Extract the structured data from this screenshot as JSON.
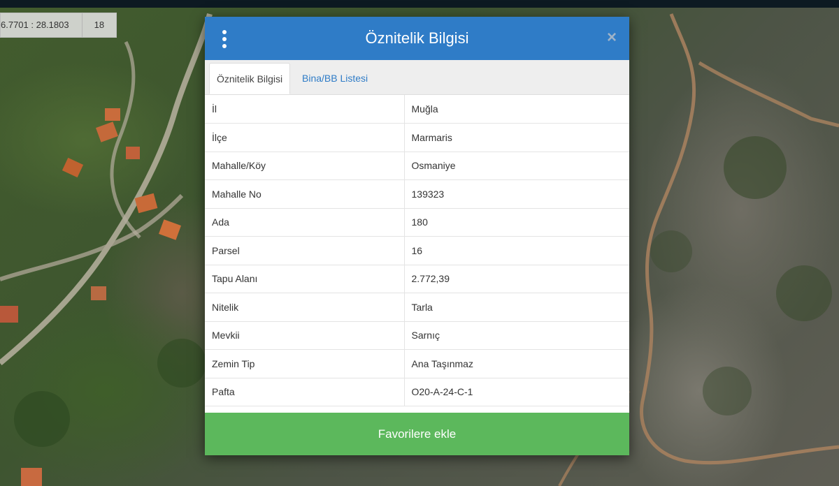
{
  "map": {
    "coordinates": "6.7701 : 28.1803",
    "zoom_level": "18"
  },
  "modal": {
    "title": "Öznitelik Bilgisi",
    "tabs": [
      {
        "label": "Öznitelik Bilgisi",
        "active": true
      },
      {
        "label": "Bina/BB Listesi",
        "active": false
      }
    ],
    "rows": [
      {
        "key": "İl",
        "value": "Muğla"
      },
      {
        "key": "İlçe",
        "value": "Marmaris"
      },
      {
        "key": "Mahalle/Köy",
        "value": "Osmaniye"
      },
      {
        "key": "Mahalle No",
        "value": "139323"
      },
      {
        "key": "Ada",
        "value": "180"
      },
      {
        "key": "Parsel",
        "value": "16"
      },
      {
        "key": "Tapu Alanı",
        "value": "2.772,39"
      },
      {
        "key": "Nitelik",
        "value": "Tarla"
      },
      {
        "key": "Mevkii",
        "value": "Sarnıç"
      },
      {
        "key": "Zemin Tip",
        "value": "Ana Taşınmaz"
      },
      {
        "key": "Pafta",
        "value": "O20-A-24-C-1"
      }
    ],
    "favorite_button_label": "Favorilere ekle",
    "icons": {
      "menu": "more-vertical-icon",
      "close": "close-icon"
    }
  },
  "colors": {
    "header": "#2f7cc7",
    "button": "#5cb85c",
    "tab_link": "#2f7cc7"
  }
}
